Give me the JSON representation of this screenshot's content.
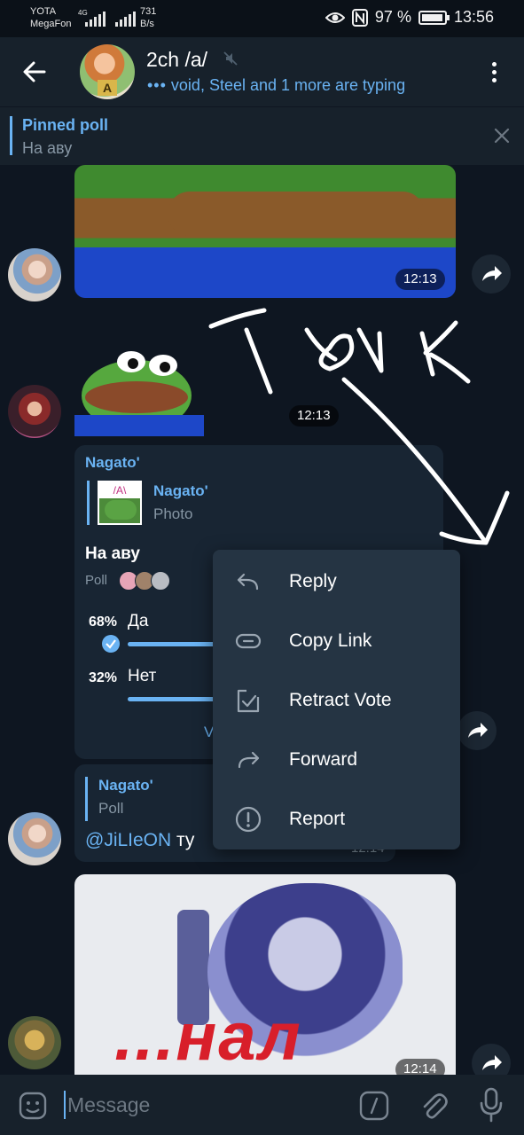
{
  "status_bar": {
    "carrier_1": "YOTA",
    "carrier_2": "MegaFon",
    "network": "4G",
    "speed": "731",
    "speed_unit": "B/s",
    "battery": "97 %",
    "battery_level": 0.97,
    "time": "13:56"
  },
  "header": {
    "title": "2ch /a/",
    "avatar_badge": "A",
    "typing_dots": "•••",
    "typing_text": "void, Steel and 1 more are typing"
  },
  "pinned": {
    "title": "Pinned poll",
    "text": "На аву"
  },
  "messages": {
    "photo_time": "12:13",
    "sticker_time": "12:13",
    "poll": {
      "forwarded_from": "Nagato'",
      "quote_name": "Nagato'",
      "quote_type": "Photo",
      "thumb_tag": "/A\\",
      "question": "На аву",
      "kind": "Poll",
      "options": [
        {
          "percent": "68%",
          "label": "Да",
          "fraction": 0.68,
          "chosen": true
        },
        {
          "percent": "32%",
          "label": "Нет",
          "fraction": 0.32,
          "chosen": false
        }
      ],
      "vote_link": "V"
    },
    "reply": {
      "quote_name": "Nagato'",
      "quote_type": "Poll",
      "mention": "@JiLIeON",
      "text": " ту",
      "time": "12:14"
    },
    "art_text": "...нал",
    "art_time": "12:14"
  },
  "context_menu": {
    "items": [
      {
        "label": "Reply",
        "icon": "reply-icon"
      },
      {
        "label": "Copy Link",
        "icon": "link-icon"
      },
      {
        "label": "Retract Vote",
        "icon": "retract-vote-icon"
      },
      {
        "label": "Forward",
        "icon": "forward-icon"
      },
      {
        "label": "Report",
        "icon": "report-icon"
      }
    ]
  },
  "composer": {
    "placeholder": "Message"
  },
  "annotation": {
    "handwritten_text": "ТЫК"
  },
  "colors": {
    "background": "#0e1621",
    "panel": "#17212b",
    "bubble": "#182533",
    "accent": "#6ab3f3",
    "menu": "#253443"
  }
}
